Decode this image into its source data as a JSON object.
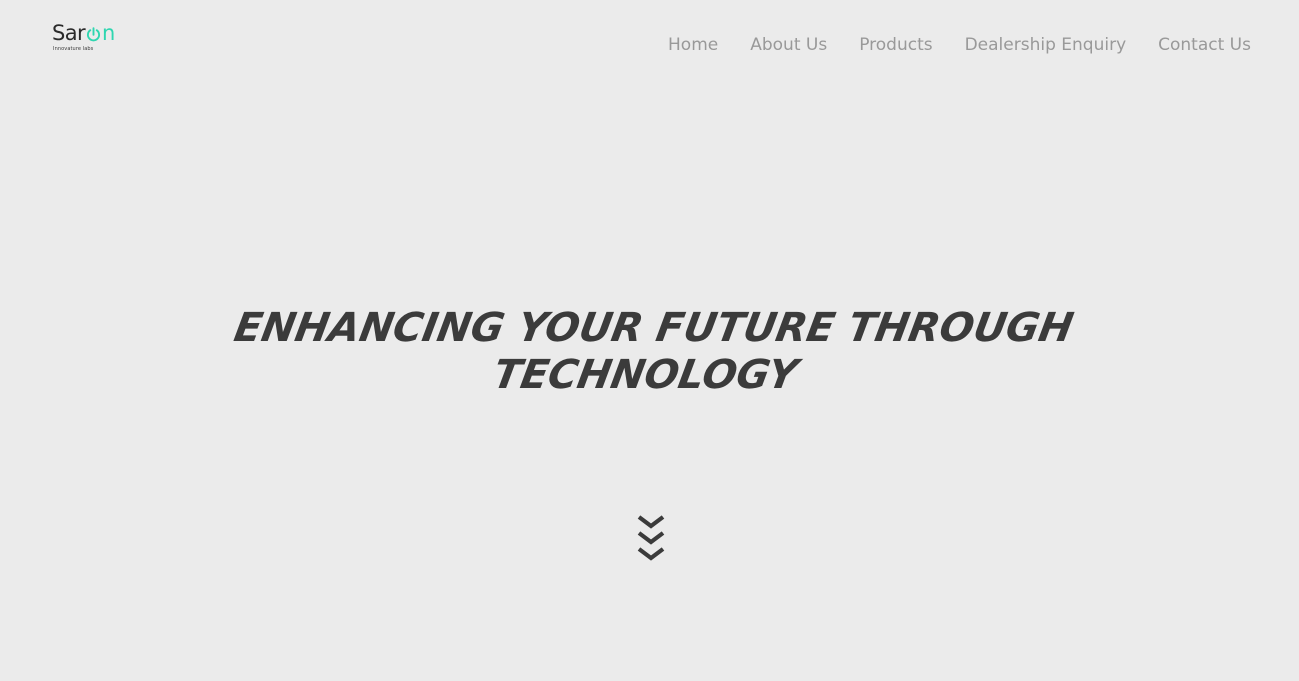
{
  "brand": {
    "name_part1": "Sar",
    "name_o": "o",
    "name_part2": "n",
    "tagline": "Innovature labs",
    "colors": {
      "text": "#2a2a2a",
      "accent": "#2fd6b0"
    }
  },
  "nav": {
    "items": [
      {
        "label": "Home"
      },
      {
        "label": "About Us"
      },
      {
        "label": "Products"
      },
      {
        "label": "Dealership Enquiry"
      },
      {
        "label": "Contact Us"
      }
    ]
  },
  "hero": {
    "line1": "ENHANCING YOUR FUTURE THROUGH",
    "line2": "TECHNOLOGY",
    "scroll_icon": "triple-chevron-down-icon"
  },
  "colors": {
    "background": "#ebebeb",
    "nav_text": "#999999",
    "hero_text": "#3b3b3b"
  }
}
